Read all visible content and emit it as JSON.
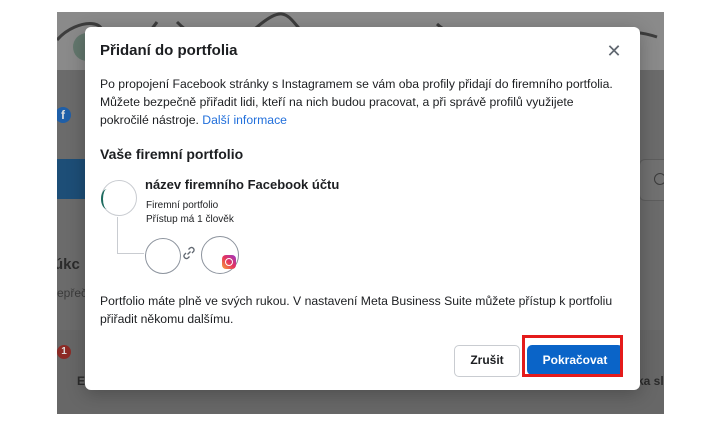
{
  "background": {
    "fragment_left_heading": "úkc",
    "fragment_left_sub": "epřeč",
    "fragment_right": "ka sl",
    "fragment_e": "E",
    "notification_count": "1",
    "fb_badge": "f"
  },
  "modal": {
    "title": "Přidaní do portfolia",
    "close_glyph": "✕",
    "intro_text": "Po propojení Facebook stránky s Instagramem se vám oba profily přidají do firemního portfolia. Můžete bezpečně přiřadit lidi, kteří na nich budou pracovat, a při správě profilů využijete pokročilé nástroje. ",
    "intro_link": "Další informace",
    "section_title": "Vaše firemní portfolio",
    "page_name": "název firemního Facebook účtu",
    "page_type": "Firemní portfolio",
    "page_access": "Přístup má 1 člověk",
    "footer_text": "Portfolio máte plně ve svých rukou. V nastavení Meta Business Suite můžete přístup k portfoliu přiřadit někomu dalšímu.",
    "cancel_label": "Zrušit",
    "continue_label": "Pokračovat"
  },
  "icons": {
    "close": "close-icon",
    "link": "link-icon",
    "instagram": "instagram-icon"
  },
  "colors": {
    "primary_button": "#0a64c8",
    "highlight": "#e41b1b",
    "link": "#216fdb"
  }
}
